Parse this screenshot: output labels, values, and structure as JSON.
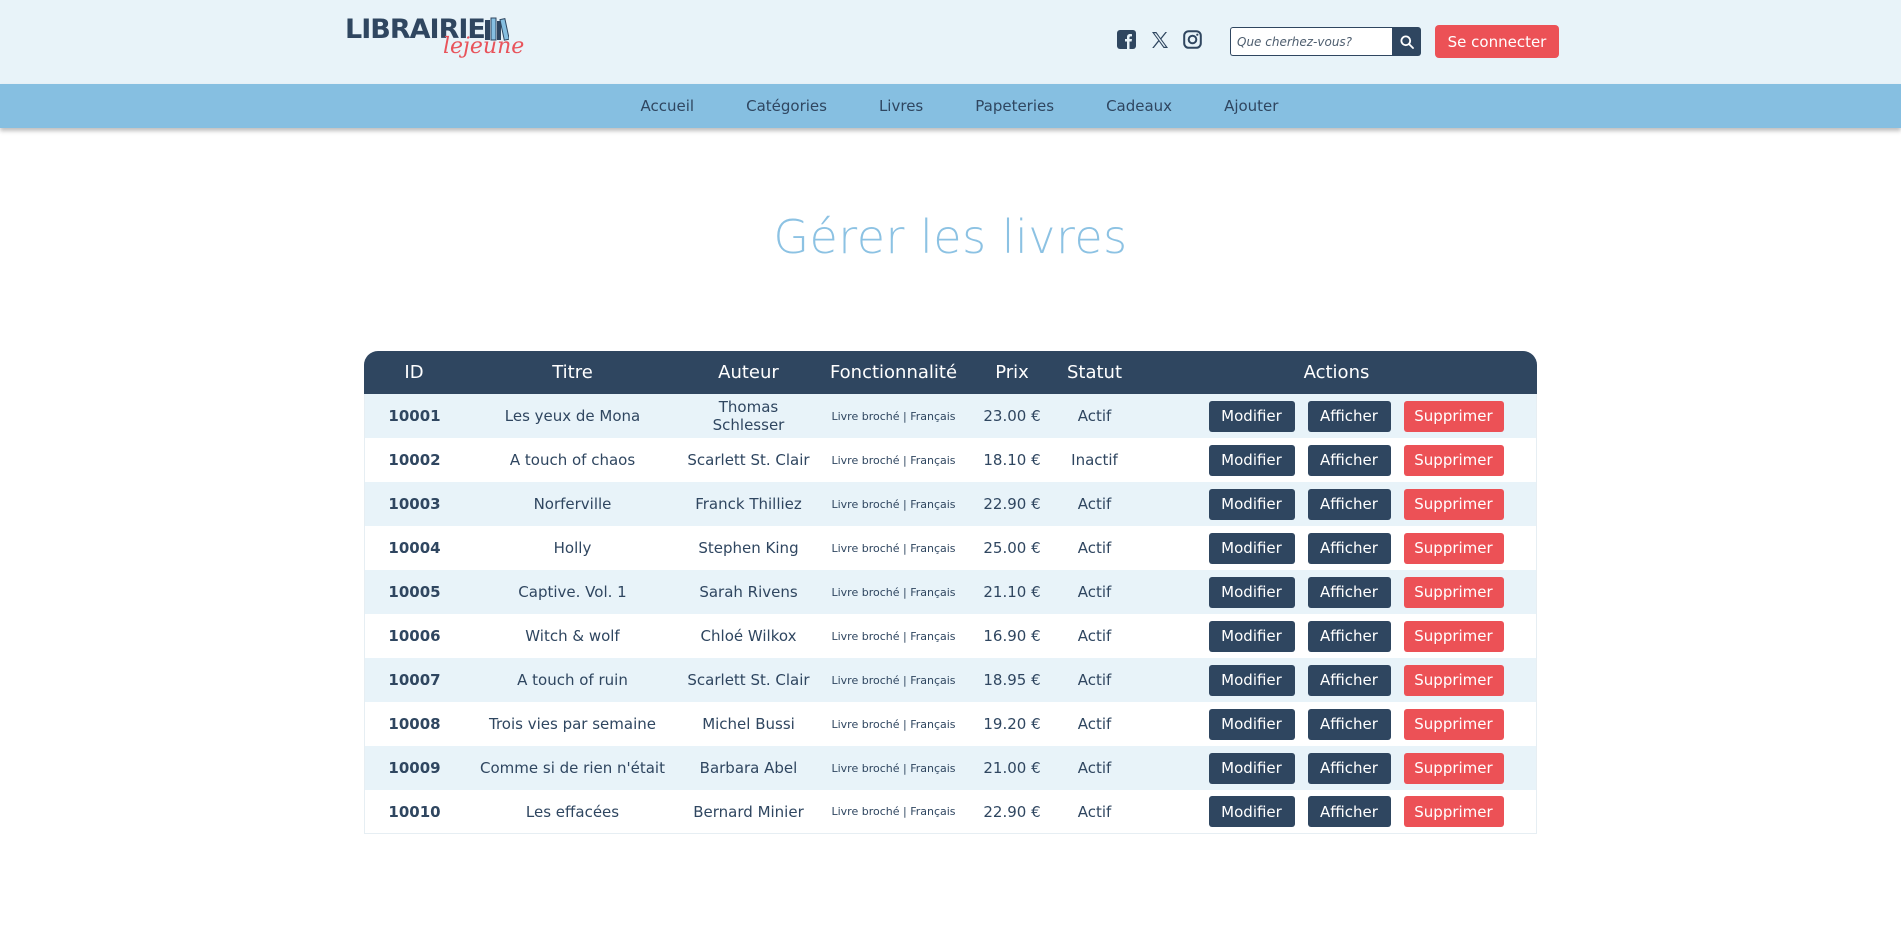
{
  "header": {
    "logo_text": "LIBRAIRIE",
    "logo_script": "lejeune",
    "search_placeholder": "Que cherhez-vous?",
    "login_label": "Se connecter",
    "socials": [
      "facebook-icon",
      "x-icon",
      "instagram-icon"
    ]
  },
  "nav": {
    "items": [
      {
        "label": "Accueil"
      },
      {
        "label": "Catégories"
      },
      {
        "label": "Livres"
      },
      {
        "label": "Papeteries"
      },
      {
        "label": "Cadeaux"
      },
      {
        "label": "Ajouter"
      }
    ]
  },
  "page": {
    "title": "Gérer les livres"
  },
  "table": {
    "columns": [
      "ID",
      "Titre",
      "Auteur",
      "Fonctionnalité",
      "Prix",
      "Statut",
      "Actions"
    ],
    "action_labels": {
      "edit": "Modifier",
      "view": "Afficher",
      "delete": "Supprimer"
    },
    "rows": [
      {
        "id": "10001",
        "title": "Les yeux de Mona",
        "author": "Thomas Schlesser",
        "feature": "Livre broché | Français",
        "price": "23.00 €",
        "status": "Actif"
      },
      {
        "id": "10002",
        "title": "A touch of chaos",
        "author": "Scarlett St. Clair",
        "feature": "Livre broché | Français",
        "price": "18.10 €",
        "status": "Inactif"
      },
      {
        "id": "10003",
        "title": "Norferville",
        "author": "Franck Thilliez",
        "feature": "Livre broché | Français",
        "price": "22.90 €",
        "status": "Actif"
      },
      {
        "id": "10004",
        "title": "Holly",
        "author": "Stephen King",
        "feature": "Livre broché | Français",
        "price": "25.00 €",
        "status": "Actif"
      },
      {
        "id": "10005",
        "title": "Captive. Vol. 1",
        "author": "Sarah Rivens",
        "feature": "Livre broché | Français",
        "price": "21.10 €",
        "status": "Actif"
      },
      {
        "id": "10006",
        "title": "Witch & wolf",
        "author": "Chloé Wilkox",
        "feature": "Livre broché | Français",
        "price": "16.90 €",
        "status": "Actif"
      },
      {
        "id": "10007",
        "title": "A touch of ruin",
        "author": "Scarlett St. Clair",
        "feature": "Livre broché | Français",
        "price": "18.95 €",
        "status": "Actif"
      },
      {
        "id": "10008",
        "title": "Trois vies par semaine",
        "author": "Michel Bussi",
        "feature": "Livre broché | Français",
        "price": "19.20 €",
        "status": "Actif"
      },
      {
        "id": "10009",
        "title": "Comme si de rien n'était",
        "author": "Barbara Abel",
        "feature": "Livre broché | Français",
        "price": "21.00 €",
        "status": "Actif"
      },
      {
        "id": "10010",
        "title": "Les effacées",
        "author": "Bernard Minier",
        "feature": "Livre broché | Français",
        "price": "22.90 €",
        "status": "Actif"
      }
    ]
  },
  "colors": {
    "navy": "#2f4660",
    "nav_blue": "#86bfe1",
    "header_bg": "#e8f3f9",
    "accent_red": "#ec5156",
    "title_blue": "#8cc2e3"
  }
}
